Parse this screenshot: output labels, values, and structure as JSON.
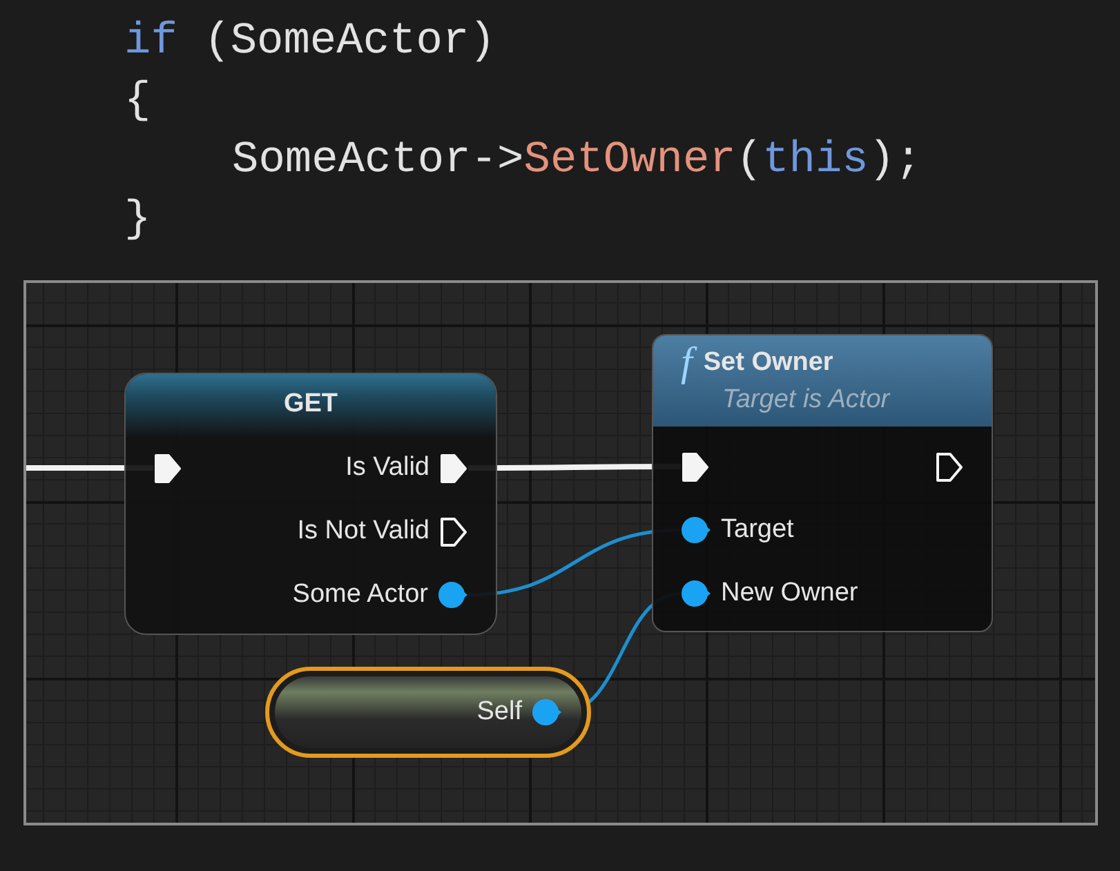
{
  "code": {
    "lines": [
      {
        "tokens": [
          {
            "text": "if",
            "kind": "keyword"
          },
          {
            "text": " (SomeActor)",
            "kind": "plain"
          }
        ]
      },
      {
        "tokens": [
          {
            "text": "{",
            "kind": "plain"
          }
        ],
        "children": [
          {
            "tokens": [
              {
                "text": "SomeActor->",
                "kind": "plain"
              },
              {
                "text": "SetOwner",
                "kind": "function"
              },
              {
                "text": "(",
                "kind": "plain"
              },
              {
                "text": "this",
                "kind": "keyword"
              },
              {
                "text": ");",
                "kind": "plain"
              }
            ]
          }
        ]
      },
      {
        "tokens": [
          {
            "text": "}",
            "kind": "plain"
          }
        ]
      }
    ]
  },
  "graph": {
    "nodes": [
      {
        "kind": "macro",
        "title": "GET",
        "rows": [
          {
            "left": {
              "kind": "exec",
              "connected": true
            },
            "right": {
              "kind": "exec",
              "label": "Is Valid",
              "connected": true
            }
          },
          {
            "right": {
              "kind": "exec",
              "label": "Is Not Valid",
              "connected": false
            }
          },
          {
            "right": {
              "kind": "object",
              "label": "Some Actor",
              "connected": true
            }
          }
        ]
      },
      {
        "kind": "function",
        "icon": "f",
        "title": "Set Owner",
        "subtitle": "Target is Actor",
        "rows": [
          {
            "left": {
              "kind": "exec",
              "connected": true
            },
            "right": {
              "kind": "exec",
              "connected": false
            }
          },
          {
            "left": {
              "kind": "object",
              "label": "Target",
              "connected": true
            }
          },
          {
            "left": {
              "kind": "object",
              "label": "New Owner",
              "connected": true
            }
          }
        ]
      },
      {
        "kind": "self",
        "rows": [
          {
            "right": {
              "kind": "object",
              "label": "Self",
              "connected": true
            }
          }
        ]
      }
    ]
  }
}
